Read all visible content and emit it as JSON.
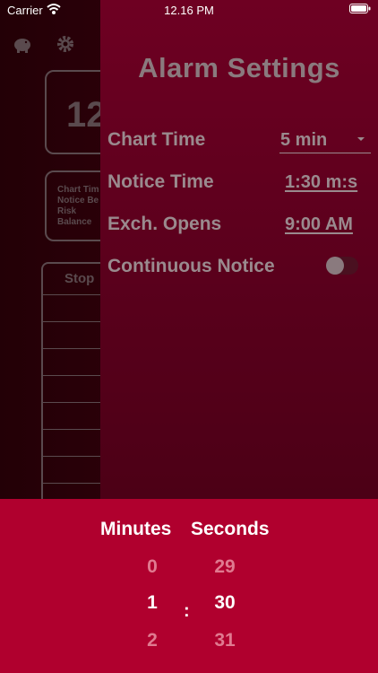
{
  "status_bar": {
    "carrier": "Carrier",
    "time": "12.16 PM"
  },
  "background": {
    "top_left_icon": "piggy-bank-icon",
    "top_right_icon": "gear-icon",
    "big_time_partial": "12",
    "info_lines": [
      "Chart Tim",
      "Notice Be",
      "Risk",
      "Balance"
    ],
    "table_header_partial": "Stop"
  },
  "settings": {
    "title": "Alarm Settings",
    "chart_time_label": "Chart Time",
    "chart_time_value": "5 min",
    "notice_time_label": "Notice Time",
    "notice_time_value": "1:30 m:s",
    "exch_opens_label": "Exch. Opens",
    "exch_opens_value": "9:00 AM",
    "continuous_notice_label": "Continuous Notice",
    "continuous_notice_on": false
  },
  "picker": {
    "minutes_header": "Minutes",
    "seconds_header": "Seconds",
    "minutes": [
      "0",
      "1",
      "2"
    ],
    "seconds": [
      "29",
      "30",
      "31"
    ],
    "separator": ":"
  },
  "colors": {
    "panel": "#6e0022",
    "picker": "#b0002e",
    "muted_text": "#9a8a8e"
  }
}
